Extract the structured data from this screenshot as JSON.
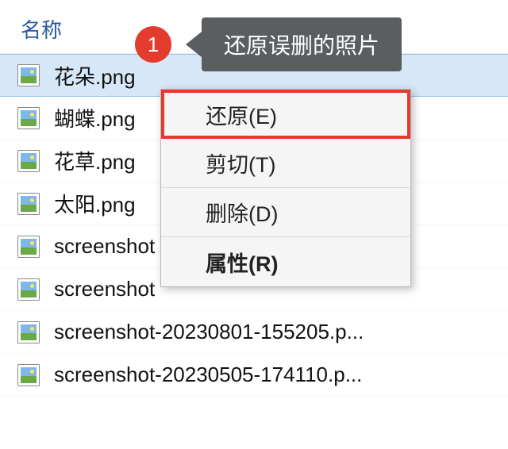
{
  "header": {
    "column": "名称"
  },
  "files": [
    {
      "name": "花朵.png",
      "selected": true
    },
    {
      "name": "蝴蝶.png",
      "selected": false
    },
    {
      "name": "花草.png",
      "selected": false
    },
    {
      "name": "太阳.png",
      "selected": false
    },
    {
      "name": "screenshot",
      "selected": false
    },
    {
      "name": "screenshot",
      "selected": false
    },
    {
      "name": "screenshot-20230801-155205.p...",
      "selected": false
    },
    {
      "name": "screenshot-20230505-174110.p...",
      "selected": false
    }
  ],
  "callout": {
    "badge": "1",
    "text": "还原误删的照片"
  },
  "contextMenu": {
    "items": [
      {
        "label": "还原(E)",
        "highlighted": true,
        "bold": false
      },
      {
        "label": "剪切(T)",
        "highlighted": false,
        "bold": false
      },
      {
        "label": "删除(D)",
        "highlighted": false,
        "bold": false
      },
      {
        "label": "属性(R)",
        "highlighted": false,
        "bold": true
      }
    ]
  }
}
